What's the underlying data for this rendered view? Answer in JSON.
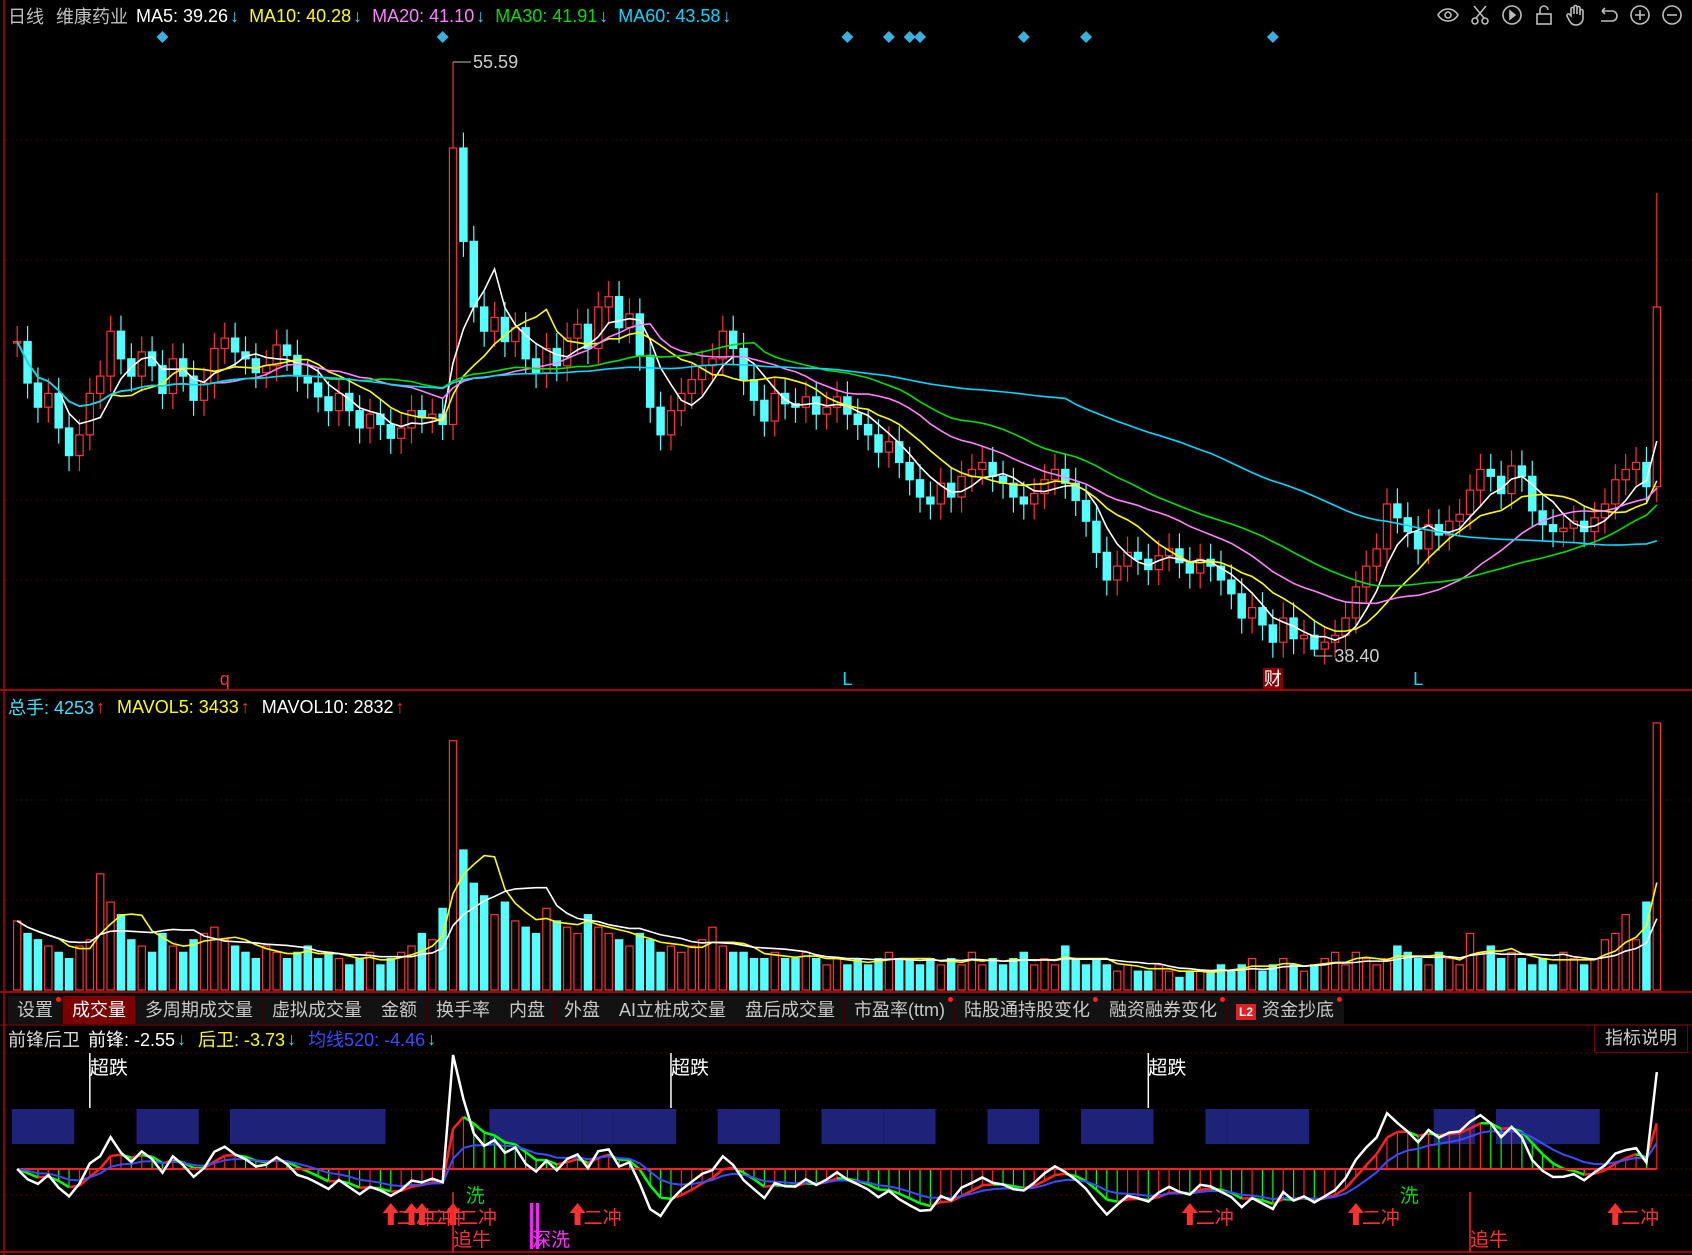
{
  "header": {
    "period": "日线",
    "stock_name": "维康药业",
    "ma": [
      {
        "label": "MA5: 39.26",
        "dir": "↓",
        "color": "#ffffff"
      },
      {
        "label": "MA10: 40.28",
        "dir": "↓",
        "color": "#ffff00"
      },
      {
        "label": "MA20: 41.10",
        "dir": "↓",
        "color": "#ff80ff"
      },
      {
        "label": "MA30: 41.91",
        "dir": "↓",
        "color": "#00e000"
      },
      {
        "label": "MA60: 43.58",
        "dir": "↓",
        "color": "#00d8ff"
      }
    ]
  },
  "toolbar_icons": [
    "eye-icon",
    "scissors-icon",
    "play-circle-icon",
    "lock-icon",
    "hand-icon",
    "undo-icon",
    "zoom-in-icon",
    "zoom-out-icon"
  ],
  "colors": {
    "up": "#ff3232",
    "down": "#54ffff",
    "ma5": "#ffffff",
    "ma10": "#ffff00",
    "ma20": "#ff80ff",
    "ma30": "#00e000",
    "ma60": "#00d8ff",
    "signal_block": "#1e2278",
    "indicator_blue": "#3a4cff"
  },
  "main": {
    "high_mark": {
      "index": 42,
      "value": "55.59"
    },
    "low_mark": {
      "index": 125,
      "value": "38.40"
    },
    "last_high": 51.8,
    "diamonds": [
      14,
      41,
      80,
      84,
      86,
      87,
      97,
      103,
      121
    ],
    "markers": [
      {
        "index": 20,
        "text": "q",
        "color": "#ff3030"
      },
      {
        "index": 80,
        "text": "L",
        "color": "#00e0ff"
      },
      {
        "index": 135,
        "text": "L",
        "color": "#00e0ff"
      },
      {
        "index": 121,
        "text": "财",
        "color": "#ffffff",
        "bg": "#8b0000"
      }
    ]
  },
  "chart_data": {
    "type": "candlestick",
    "closes": [
      47.5,
      46.3,
      45.6,
      46.0,
      45.0,
      44.2,
      44.8,
      46.0,
      46.5,
      47.8,
      47.0,
      46.5,
      47.2,
      46.8,
      46.0,
      47.0,
      46.5,
      45.8,
      46.3,
      47.3,
      47.6,
      47.2,
      47.0,
      46.6,
      46.8,
      47.4,
      47.1,
      46.5,
      46.3,
      45.9,
      45.5,
      46.0,
      45.5,
      45.0,
      45.4,
      45.1,
      44.7,
      45.0,
      45.5,
      45.3,
      45.4,
      45.1,
      53.1,
      50.4,
      48.5,
      47.8,
      48.2,
      47.5,
      47.9,
      47.0,
      46.6,
      47.3,
      46.8,
      47.6,
      48.0,
      47.3,
      48.5,
      48.8,
      47.9,
      48.3,
      47.1,
      45.6,
      44.8,
      45.5,
      46.0,
      46.4,
      46.8,
      47.0,
      47.8,
      47.3,
      46.4,
      45.8,
      45.2,
      46.0,
      45.7,
      45.6,
      45.9,
      45.4,
      45.6,
      45.9,
      45.4,
      45.1,
      44.8,
      44.3,
      44.6,
      44.0,
      43.5,
      43.0,
      42.8,
      43.4,
      43.0,
      43.6,
      43.8,
      44.0,
      43.6,
      43.4,
      43.0,
      42.8,
      43.1,
      43.5,
      43.8,
      43.4,
      42.9,
      42.3,
      41.4,
      40.6,
      41.0,
      41.4,
      41.2,
      40.9,
      41.3,
      41.5,
      41.1,
      40.8,
      41.2,
      41.0,
      40.6,
      40.2,
      39.5,
      39.8,
      39.3,
      38.8,
      39.5,
      38.9,
      39.0,
      38.6,
      38.8,
      39.0,
      39.5,
      40.4,
      41.0,
      41.5,
      42.8,
      42.4,
      42.0,
      41.5,
      42.2,
      41.9,
      42.3,
      42.5,
      43.2,
      43.8,
      43.6,
      43.1,
      43.9,
      43.6,
      42.6,
      42.2,
      42.0,
      42.1,
      42.3,
      42.0,
      42.4,
      42.8,
      43.5,
      43.8,
      44.0,
      43.3,
      48.5
    ],
    "volumes": [
      1100,
      900,
      800,
      700,
      600,
      500,
      700,
      800,
      1850,
      1400,
      1200,
      800,
      700,
      600,
      900,
      700,
      600,
      800,
      900,
      1000,
      800,
      700,
      600,
      500,
      700,
      600,
      500,
      600,
      700,
      500,
      600,
      500,
      400,
      500,
      600,
      400,
      500,
      600,
      700,
      900,
      800,
      1300,
      3970,
      2230,
      1700,
      1500,
      1200,
      1400,
      1100,
      1000,
      900,
      1300,
      1100,
      1000,
      900,
      1200,
      1000,
      900,
      800,
      700,
      900,
      800,
      600,
      700,
      600,
      700,
      800,
      1000,
      700,
      600,
      600,
      500,
      500,
      600,
      500,
      500,
      600,
      500,
      400,
      500,
      400,
      500,
      400,
      500,
      600,
      500,
      500,
      400,
      500,
      400,
      500,
      400,
      600,
      400,
      500,
      400,
      500,
      600,
      400,
      500,
      400,
      700,
      500,
      400,
      500,
      400,
      300,
      400,
      300,
      300,
      400,
      300,
      200,
      300,
      300,
      300,
      400,
      300,
      400,
      500,
      300,
      400,
      500,
      400,
      300,
      400,
      500,
      600,
      400,
      600,
      500,
      400,
      500,
      700,
      600,
      500,
      400,
      600,
      500,
      400,
      900,
      600,
      700,
      500,
      600,
      500,
      400,
      500,
      400,
      600,
      500,
      400,
      500,
      800,
      900,
      1200,
      800,
      1400,
      4253
    ]
  },
  "volume_header": {
    "total": "总手: 4253",
    "total_dir": "↑",
    "mavol5": "MAVOL5: 3433",
    "mavol5_dir": "↑",
    "mavol10": "MAVOL10: 2832",
    "mavol10_dir": "↑"
  },
  "tabs": [
    {
      "label": "设置",
      "dot": true,
      "active": false
    },
    {
      "label": "成交量",
      "dot": false,
      "active": true
    },
    {
      "label": "多周期成交量",
      "dot": false,
      "active": false
    },
    {
      "label": "虚拟成交量",
      "dot": false,
      "active": false
    },
    {
      "label": "金额",
      "dot": false,
      "active": false
    },
    {
      "label": "换手率",
      "dot": false,
      "active": false
    },
    {
      "label": "内盘",
      "dot": false,
      "active": false
    },
    {
      "label": "外盘",
      "dot": false,
      "active": false
    },
    {
      "label": "AI立桩成交量",
      "dot": false,
      "active": false
    },
    {
      "label": "盘后成交量",
      "dot": false,
      "active": false
    },
    {
      "label": "市盈率(ttm)",
      "dot": true,
      "active": false
    },
    {
      "label": "陆股通持股变化",
      "dot": true,
      "active": false
    },
    {
      "label": "融资融券变化",
      "dot": true,
      "active": false
    },
    {
      "label": "资金抄底",
      "dot": true,
      "active": false,
      "badge": "L2"
    }
  ],
  "indicator": {
    "name": "前锋后卫",
    "front": "前锋: -2.55",
    "front_dir": "↓",
    "back": "后卫: -3.73",
    "back_dir": "↓",
    "ma520": "均线520: -4.46",
    "ma520_dir": "↓",
    "explain_button": "指标说明",
    "blocks": [
      [
        0,
        5
      ],
      [
        12,
        17
      ],
      [
        21,
        35
      ],
      [
        46,
        54
      ],
      [
        55,
        57
      ],
      [
        58,
        63
      ],
      [
        68,
        73
      ],
      [
        78,
        83
      ],
      [
        84,
        88
      ],
      [
        94,
        98
      ],
      [
        103,
        109
      ],
      [
        115,
        116
      ],
      [
        117,
        124
      ],
      [
        137,
        140
      ],
      [
        143,
        152
      ]
    ],
    "signals": [
      {
        "type": "oversold",
        "index": 7,
        "text": "超跌"
      },
      {
        "type": "oversold",
        "index": 63,
        "text": "超跌"
      },
      {
        "type": "oversold",
        "index": 109,
        "text": "超跌"
      },
      {
        "type": "wash",
        "index": 44,
        "text": "洗"
      },
      {
        "type": "wash",
        "index": 134,
        "text": "洗"
      },
      {
        "type": "second-rush",
        "index": 36,
        "text": "二冲"
      },
      {
        "type": "second-rush",
        "index": 38,
        "text": "二冲"
      },
      {
        "type": "second-rush",
        "index": 39,
        "text": "二冲"
      },
      {
        "type": "second-rush",
        "index": 42,
        "text": "二冲"
      },
      {
        "type": "second-rush",
        "index": 54,
        "text": "二冲"
      },
      {
        "type": "second-rush",
        "index": 113,
        "text": "二冲"
      },
      {
        "type": "second-rush",
        "index": 129,
        "text": "二冲"
      },
      {
        "type": "second-rush",
        "index": 154,
        "text": "二冲"
      },
      {
        "type": "chase-bull",
        "index": 42,
        "text": "追牛"
      },
      {
        "type": "chase-bull",
        "index": 140,
        "text": "追牛"
      },
      {
        "type": "deep-wash",
        "index": 50,
        "text": "深洗"
      }
    ]
  }
}
